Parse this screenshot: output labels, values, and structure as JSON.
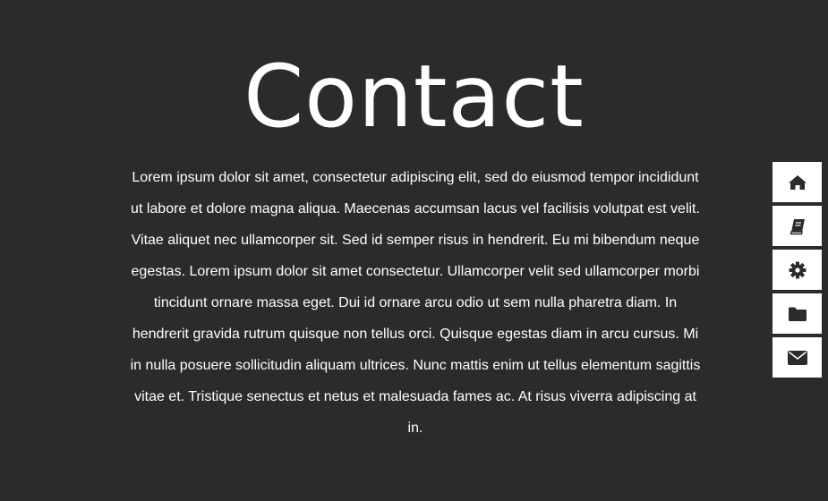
{
  "page": {
    "title": "Contact",
    "body": "Lorem ipsum dolor sit amet, consectetur adipiscing elit, sed do eiusmod tempor incididunt ut labore et dolore magna aliqua. Maecenas accumsan lacus vel facilisis volutpat est velit. Vitae aliquet nec ullamcorper sit. Sed id semper risus in hendrerit. Eu mi bibendum neque egestas. Lorem ipsum dolor sit amet consectetur. Ullamcorper velit sed ullamcorper morbi tincidunt ornare massa eget. Dui id ornare arcu odio ut sem nulla pharetra diam. In hendrerit gravida rutrum quisque non tellus orci. Quisque egestas diam in arcu cursus. Mi in nulla posuere sollicitudin aliquam ultrices. Nunc mattis enim ut tellus elementum sagittis vitae et. Tristique senectus et netus et malesuada fames ac. At risus viverra adipiscing at in."
  },
  "colors": {
    "background": "#2b2b2b",
    "text": "#ffffff",
    "nav_button": "#ffffff",
    "nav_icon": "#2b2b2b"
  },
  "nav": {
    "items": [
      {
        "icon": "home-icon"
      },
      {
        "icon": "book-icon"
      },
      {
        "icon": "gear-icon"
      },
      {
        "icon": "folder-icon"
      },
      {
        "icon": "envelope-icon"
      }
    ]
  }
}
